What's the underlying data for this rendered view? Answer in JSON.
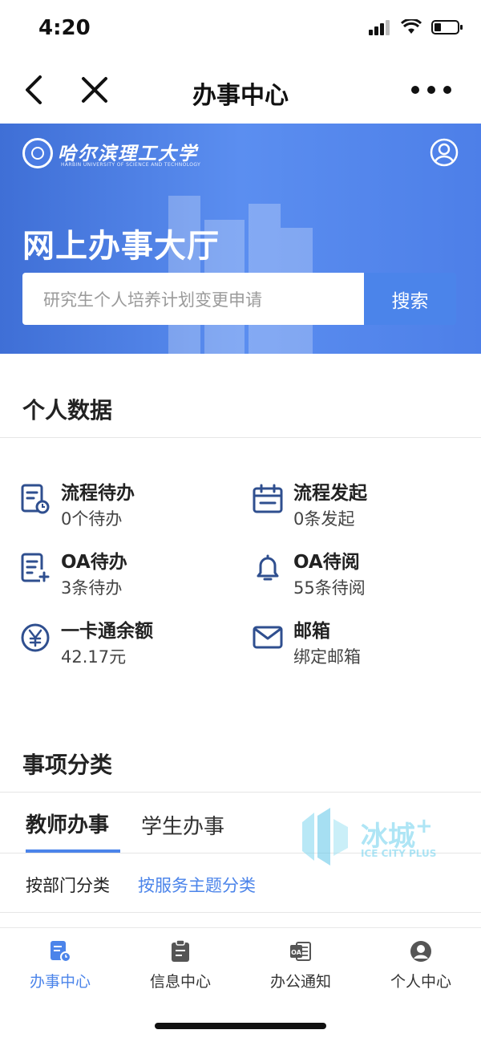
{
  "status": {
    "time": "4:20"
  },
  "nav": {
    "title": "办事中心"
  },
  "banner": {
    "logo_name": "哈尔滨理工大学",
    "logo_sub": "HARBIN UNIVERSITY OF SCIENCE AND TECHNOLOGY",
    "title": "网上办事大厅",
    "search_placeholder": "研究生个人培养计划变更申请",
    "search_button": "搜索"
  },
  "personal": {
    "title": "个人数据",
    "items": [
      {
        "icon": "process-todo-icon",
        "title": "流程待办",
        "sub": "0个待办"
      },
      {
        "icon": "calendar-icon",
        "title": "流程发起",
        "sub": "0条发起"
      },
      {
        "icon": "document-add-icon",
        "title": "OA待办",
        "sub": "3条待办"
      },
      {
        "icon": "bell-icon",
        "title": "OA待阅",
        "sub": "55条待阅"
      },
      {
        "icon": "yuan-icon",
        "title": "一卡通余额",
        "sub": "42.17元"
      },
      {
        "icon": "mail-icon",
        "title": "邮箱",
        "sub": "绑定邮箱"
      }
    ]
  },
  "category": {
    "title": "事项分类",
    "tabs": [
      "教师办事",
      "学生办事"
    ],
    "filters": [
      "按部门分类",
      "按服务主题分类"
    ]
  },
  "watermark": {
    "cn": "冰城",
    "en": "ICE CITY PLUS"
  },
  "bottom_nav": [
    {
      "label": "办事中心",
      "active": true
    },
    {
      "label": "信息中心",
      "active": false
    },
    {
      "label": "办公通知",
      "active": false
    },
    {
      "label": "个人中心",
      "active": false
    }
  ],
  "colors": {
    "accent": "#4b84ea",
    "banner": "#4a7be3",
    "icon": "#2f4f8f"
  }
}
